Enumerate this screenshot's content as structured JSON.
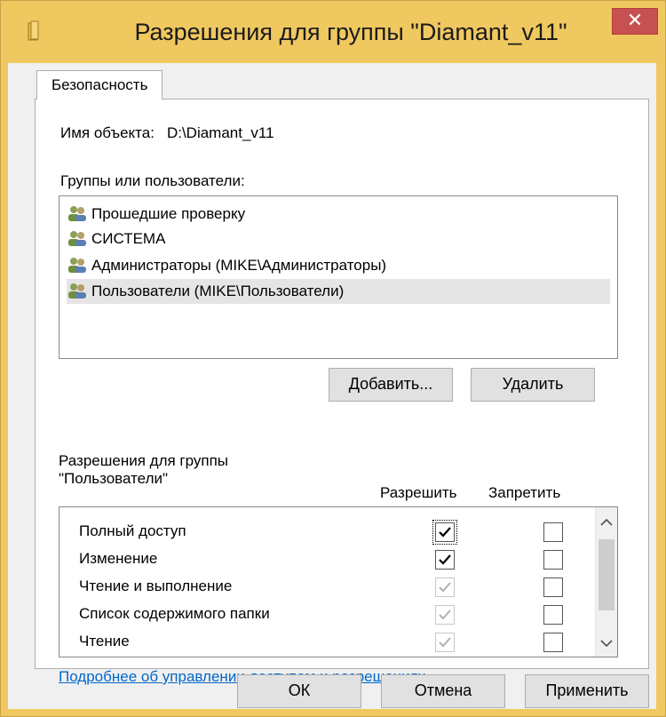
{
  "window": {
    "title": "Разрешения для группы \"Diamant_v11\"",
    "close_label": "✕"
  },
  "tab": {
    "label": "Безопасность"
  },
  "object": {
    "label": "Имя объекта:",
    "value": "D:\\Diamant_v11"
  },
  "groups": {
    "label": "Группы или пользователи:",
    "items": [
      {
        "name": "Прошедшие проверку",
        "icon": "users-icon",
        "selected": false
      },
      {
        "name": "СИСТЕМА",
        "icon": "users-icon",
        "selected": false
      },
      {
        "name": "Администраторы (MIKE\\Администраторы)",
        "icon": "users-icon",
        "selected": false
      },
      {
        "name": "Пользователи (MIKE\\Пользователи)",
        "icon": "users-icon",
        "selected": true
      }
    ]
  },
  "buttons": {
    "add": "Добавить...",
    "remove": "Удалить"
  },
  "permissions": {
    "title_line1": "Разрешения для группы",
    "title_line2": "\"Пользователи\"",
    "allow_header": "Разрешить",
    "deny_header": "Запретить",
    "rows": [
      {
        "name": "Полный доступ",
        "allow": "checked",
        "deny": "unchecked"
      },
      {
        "name": "Изменение",
        "allow": "checked",
        "deny": "unchecked"
      },
      {
        "name": "Чтение и выполнение",
        "allow": "inherited",
        "deny": "unchecked"
      },
      {
        "name": "Список содержимого папки",
        "allow": "inherited",
        "deny": "unchecked"
      },
      {
        "name": "Чтение",
        "allow": "inherited",
        "deny": "unchecked"
      }
    ]
  },
  "help_link": "Подробнее об управлении доступом и разрешениях",
  "footer": {
    "ok": "ОК",
    "cancel": "Отмена",
    "apply": "Применить"
  }
}
